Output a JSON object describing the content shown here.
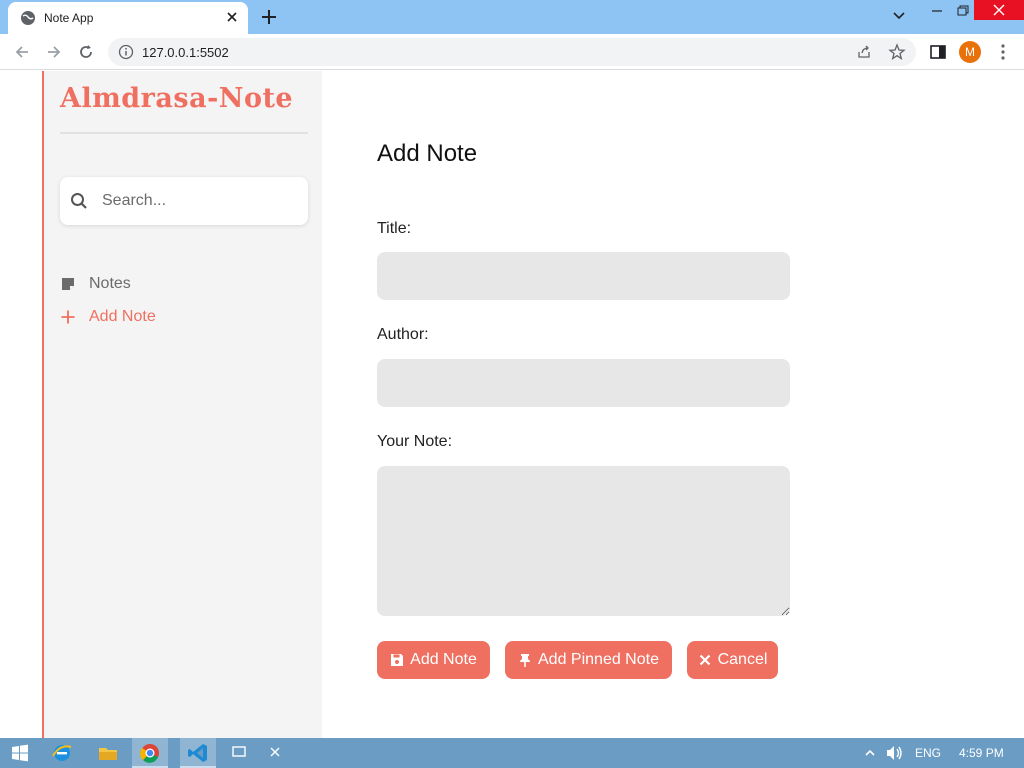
{
  "browser": {
    "tab_title": "Note App",
    "url": "127.0.0.1:5502",
    "profile_initial": "M"
  },
  "sidebar": {
    "brand": "Almdrasa-Note",
    "search_placeholder": "Search...",
    "nav": [
      {
        "label": "Notes",
        "icon": "note-icon",
        "active": false
      },
      {
        "label": "Add Note",
        "icon": "plus-icon",
        "active": true
      }
    ]
  },
  "form": {
    "heading": "Add Note",
    "title_label": "Title:",
    "author_label": "Author:",
    "note_label": "Your Note:",
    "title_value": "",
    "author_value": "",
    "note_value": ""
  },
  "buttons": {
    "add": "Add Note",
    "pinned": "Add Pinned Note",
    "cancel": "Cancel"
  },
  "taskbar": {
    "language": "ENG",
    "time": "4:59 PM"
  },
  "colors": {
    "accent": "#ef6f60",
    "sidebar_bg": "#f4f4f4",
    "field_bg": "#e7e7e8",
    "titlebar": "#8dc4f4",
    "taskbar": "#6a9cc4"
  }
}
